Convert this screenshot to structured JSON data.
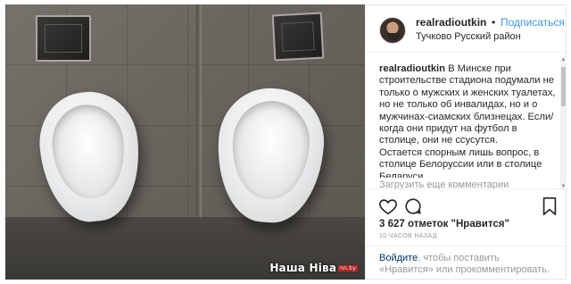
{
  "photo": {
    "alt": "",
    "watermark": "Наша Ніва",
    "watermark_small": "nn.by"
  },
  "header": {
    "username": "realradioutkin",
    "separator": "•",
    "follow_label": "Подписаться",
    "location": "Тучково Русский район"
  },
  "caption": {
    "author": "realradioutkin",
    "lines": [
      "В Минске при строительстве стадиона подумали не только о мужских и женских туалетах, но не только об инвалидах, но и о мужчинах-сиамских близнецах. Если/когда они придут на футбол в столице, они не ссусутся.",
      "Остается спорным лишь вопрос, в столице Белоруссии или в столице Беларуси."
    ]
  },
  "load_more_label": "Загрузить еще комментарии",
  "actions": {
    "like_icon": "heart-icon",
    "comment_icon": "comment-icon",
    "save_icon": "bookmark-icon"
  },
  "likes_text": "3 627 отметок \"Нравится\"",
  "timestamp": "10 ЧАСОВ НАЗАД",
  "login": {
    "link": "Войдите",
    "rest": ", чтобы поставить «Нравится» или прокомментировать."
  },
  "colors": {
    "accent": "#3897f0",
    "link_dark": "#003569",
    "muted": "#999999",
    "text": "#262626"
  }
}
